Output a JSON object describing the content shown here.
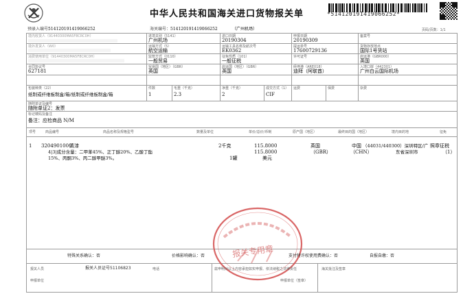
{
  "title": "中华人民共和国海关进口货物报关单",
  "barcode_number": "*514120191419066252*",
  "row1": {
    "pre_entry_label": "预录入编号：",
    "pre_entry_value": "514120191419066252",
    "customs_no_label": "海关编号：",
    "customs_no_value": "514120191419066252",
    "customs_name": "（广州机场）",
    "page_label": "页码/页数：1/1"
  },
  "consignee": {
    "label": "境内收货人（91440300MA5F8CRC0H）",
    "value": "（收货人信息已遮盖）"
  },
  "entry_port": {
    "label": "进境关别（5141）",
    "value": "广州机场"
  },
  "import_date": {
    "label": "进口日期",
    "value": "20190304"
  },
  "declare_date": {
    "label": "申报日期",
    "value": "20190309"
  },
  "record_no": {
    "label": "备案号",
    "value": ""
  },
  "overseas_shipper": {
    "label": "境外发货人（W0）",
    "value": "（发货人信息已遮盖）"
  },
  "transport_mode": {
    "label": "运输方式（5）",
    "value": "航空运输"
  },
  "transport_name": {
    "label": "运输工具名称及航次号",
    "value": "EK0362"
  },
  "bill_no": {
    "label": "提运单号",
    "value": "17600729136"
  },
  "storage_place": {
    "label": "货物存放地点",
    "value": "国际1号货站"
  },
  "consumer_unit": {
    "label": "消费使用单位（91440300MA5F8CRC0H）",
    "value": ""
  },
  "supervision_mode": {
    "label": "监管方式（0110）",
    "value": "一般贸易"
  },
  "tax_nature": {
    "label": "征免性质（101）",
    "value": "一般征税"
  },
  "license_no": {
    "label": "许可证号",
    "value": ""
  },
  "origin_port": {
    "label": "启运港（GBR000）",
    "value": "英国"
  },
  "contract_no": {
    "label": "合同协议号",
    "value": "627181"
  },
  "trade_country": {
    "label": "贸易国（地区）（GBR）",
    "value": "英国"
  },
  "departure_country": {
    "label": "启运国（地区）（GBR）",
    "value": "英国"
  },
  "transit_port": {
    "label": "经停港（ARE018）",
    "value": "迪拜（阿联酋）"
  },
  "entry_port_domestic": {
    "label": "入境口岸（442301）",
    "value": "广州白云国际机场"
  },
  "packaging": {
    "label": "包装种类（22）",
    "value": "纸制或纤维板制盒/箱/纸制或纤维板制盒/箱"
  },
  "pieces": {
    "label": "件数",
    "value": "1"
  },
  "gross_weight": {
    "label": "毛重（千克）",
    "value": "2.3"
  },
  "net_weight": {
    "label": "净重（千克）",
    "value": "2"
  },
  "transaction_mode": {
    "label": "成交方式（1）",
    "value": "CIF"
  },
  "freight": {
    "label": "运费",
    "value": ""
  },
  "insurance": {
    "label": "保费",
    "value": ""
  },
  "misc_fee": {
    "label": "杂费",
    "value": ""
  },
  "docs": {
    "label": "随附单证及编号",
    "value": "随附单证2：发票"
  },
  "marks": {
    "label": "标记唛码及备注",
    "value": "备注：应检商品 N/M"
  },
  "goods_headers": {
    "no": "项号",
    "code": "商品编号",
    "name": "商品名称及规格型号",
    "qty": "数量及单位",
    "price": "单价/总价/币制",
    "origin": "原产国（地区）",
    "final_dest": "最终目的国（地区）",
    "domestic_dest": "境内目的地",
    "tax": "征免"
  },
  "goods": [
    {
      "no": "1",
      "code": "3204901000",
      "name": "清漆",
      "spec1": "4|3|成分含量：二甲苯45%、正丁醇20%、乙酸丁酯",
      "spec2": "15%、丙酮3%、丙二醇甲醚3%。",
      "qty1": "2千克",
      "qty2": "1罐",
      "unit_price": "115.8000",
      "total_price": "115.8000",
      "currency": "美元",
      "origin": "英国",
      "origin_code": "（GBR）",
      "final_dest": "中国",
      "final_dest_code": "（CHN）",
      "domestic_dest": "（44031/440300）深圳特区/广",
      "domestic_dest2": "东省深圳市",
      "tax": "照章征税",
      "tax_code": "（1）"
    }
  ],
  "footer": {
    "special_relation": "特殊关系确认：否",
    "price_influence": "价格影响确认：否",
    "royalty": "支付特许权使用费确认：否",
    "self_pay": "自报自缴：否",
    "declarant_label": "报关人员",
    "declarant_cert": "报关人员证号51106823",
    "phone_label": "电话",
    "declaration_statement": "兹申明对以上内容承担如实申报、依法纳税之法律责任",
    "declaring_unit": "申报单位",
    "customs_remarks": "海关批注及签章",
    "unit_seal": "申报单位（签章）",
    "stamp_text": "报关专用章"
  }
}
